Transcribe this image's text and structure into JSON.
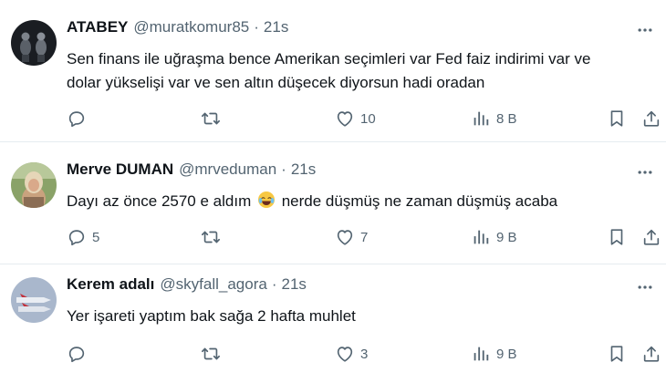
{
  "tweets": [
    {
      "name": "ATABEY",
      "handle": "@muratkomur85",
      "separator": "·",
      "time": "21s",
      "text_lines": [
        "Sen finans ile uğraşma bence Amerikan seçimleri var Fed faiz indirimi var ve",
        "dolar yükselişi var ve sen altın düşecek diyorsun hadi oradan"
      ],
      "replies": "",
      "retweets": "",
      "likes": "10",
      "views": "8 B"
    },
    {
      "name": "Merve DUMAN",
      "handle": "@mrveduman",
      "separator": "·",
      "time": "21s",
      "text_before_emoji": "Dayı az önce 2570 e aldım",
      "emoji": "face-with-tears-of-joy",
      "text_after_emoji": "nerde düşmüş ne zaman düşmüş acaba",
      "replies": "5",
      "retweets": "",
      "likes": "7",
      "views": "9 B"
    },
    {
      "name": "Kerem adalı",
      "handle": "@skyfall_agora",
      "separator": "·",
      "time": "21s",
      "text_lines": [
        "Yer işareti yaptım bak sağa 2 hafta muhlet"
      ],
      "replies": "",
      "retweets": "",
      "likes": "3",
      "views": "9 B"
    }
  ],
  "colors": {
    "text": "#0f1419",
    "secondary": "#536471",
    "divider": "#e6ecf0"
  },
  "icons": [
    "more-icon",
    "reply-icon",
    "retweet-icon",
    "like-icon",
    "views-icon",
    "bookmark-icon",
    "share-icon"
  ]
}
